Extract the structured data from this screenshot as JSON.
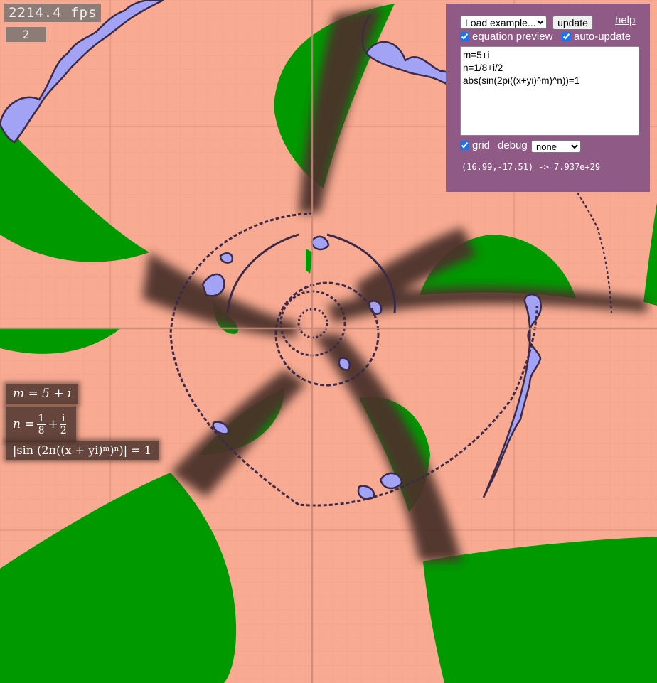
{
  "status": {
    "fps": "2214.4 fps",
    "frame_count": "2"
  },
  "controls": {
    "example_select": "Load example...",
    "update_button": "update",
    "help_link": "help",
    "equation_preview_label": "equation preview",
    "equation_preview_checked": true,
    "auto_update_label": "auto-update",
    "auto_update_checked": true,
    "equation_text": "m=5+i\nn=1/8+i/2\nabs(sin(2pi((x+yi)^m)^n))=1",
    "grid_label": "grid",
    "grid_checked": true,
    "debug_label": "debug",
    "debug_select": "none",
    "cursor_readout": "(16.99,-17.51) -> 7.937e+29"
  },
  "equation_preview": {
    "line1": "m = 5 + i",
    "line2_lhs": "n =",
    "line2_frac1_num": "1",
    "line2_frac1_den": "8",
    "line2_plus": "+",
    "line2_frac2_num": "i",
    "line2_frac2_den": "2",
    "line3": "|sin (2π((x + yi)ᵐ)ⁿ)| = 1"
  },
  "colors": {
    "background_region": "#f8ab92",
    "green_region": "#009900",
    "blue_region": "#a3a3f5",
    "curve": "#3b2a48",
    "dark_band": "#4b302b",
    "panel": "#8f5a86"
  }
}
